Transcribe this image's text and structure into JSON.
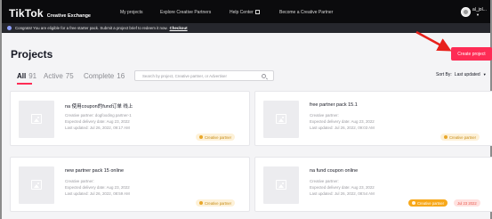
{
  "nav": {
    "logo": "TikTok",
    "logo_sub": "Creative Exchange",
    "links": [
      "My projects",
      "Explore Creative Partners",
      "Help Center",
      "Become a Creative Partner"
    ],
    "user": "al_jol..."
  },
  "banner": {
    "text": "Congrats! You are eligible for a free starter pack. Submit a project brief to redeem it now.",
    "link": "Checkout"
  },
  "page": {
    "title": "Projects",
    "create_button": "Create project"
  },
  "tabs": [
    {
      "label": "All",
      "count": "91"
    },
    {
      "label": "Active",
      "count": "75"
    },
    {
      "label": "Complete",
      "count": "16"
    }
  ],
  "search": {
    "placeholder": "Search by project, Creative partner, or Advertiser"
  },
  "sort": {
    "label": "Sort By:",
    "value": "Last updated"
  },
  "projects": [
    {
      "title": "na 使用coupon的fund订单 线上",
      "partner": "Creative partner: dogfooding partner-1",
      "delivery": "Expected delivery date: Aug 23, 2022",
      "updated": "Last updated: Jul 26, 2022, 09:17 AM",
      "badge": "Creative partner"
    },
    {
      "title": "free partner pack 15.1",
      "partner": "Creative partner:",
      "delivery": "Expected delivery date: Aug 23, 2022",
      "updated": "Last updated: Jul 26, 2022, 09:03 AM",
      "badge": "Creative partner"
    },
    {
      "title": "new partner pack 15 online",
      "partner": "Creative partner:",
      "delivery": "Expected delivery date: Aug 23, 2022",
      "updated": "Last updated: Jul 26, 2022, 08:59 AM",
      "badge": "Creative partner"
    },
    {
      "title": "na fund coupon online",
      "partner": "Creative partner:",
      "delivery": "Expected delivery date: Aug 23, 2022",
      "updated": "Last updated: Jul 26, 2022, 08:54 AM",
      "badge": "Creative partner",
      "date_badge": "Jul 23 2022"
    }
  ],
  "colors": {
    "accent": "#fe2c55",
    "nav_bg": "#0b0b0d",
    "badge_orange": "#f7a81b"
  }
}
